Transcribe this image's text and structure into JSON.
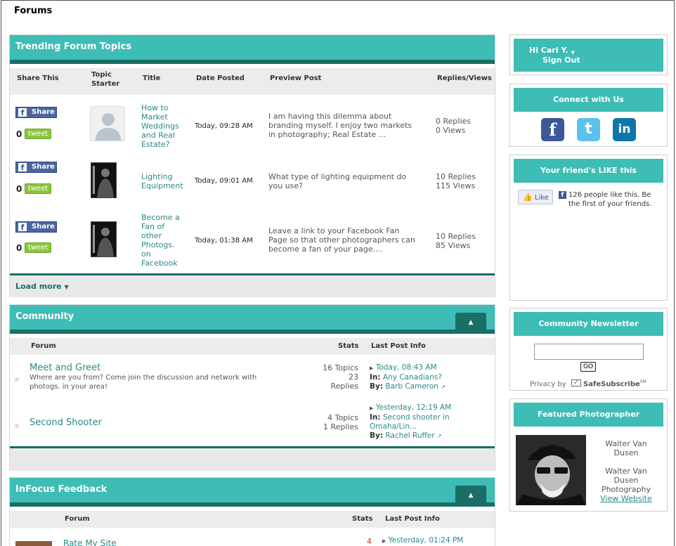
{
  "page": {
    "title": "Forums"
  },
  "trending": {
    "title": "Trending Forum Topics",
    "columns": [
      "Share This",
      "Topic Starter",
      "Title",
      "Date Posted",
      "Preview Post",
      "Replies/Views"
    ],
    "share_label": "Share",
    "tweet_label": "tweet",
    "tweet_count": "0",
    "rows": [
      {
        "title": [
          "How to",
          "Market",
          "Weddings",
          "and Real",
          "Estate?"
        ],
        "date": "Today, 09:28 AM",
        "preview": [
          "I am having this dilemma about",
          "branding myself. I enjoy two markets",
          "in photography; Real Estate ..."
        ],
        "replies": "0 Replies",
        "views": "0 Views"
      },
      {
        "title": [
          "Lighting",
          "Equipment"
        ],
        "date": "Today, 09:01 AM",
        "preview": [
          "What type of lighting equipment do",
          "you use?"
        ],
        "replies": "10 Replies",
        "views": "115 Views"
      },
      {
        "title": [
          "Become a",
          "Fan of",
          "other",
          "Photogs.",
          "on",
          "Facebook"
        ],
        "date": "Today, 01:38 AM",
        "preview": [
          "Leave a link to your Facebook Fan",
          "Page so that other photographers can",
          "become a fan of your page...."
        ],
        "replies": "10 Replies",
        "views": "85 Views"
      }
    ],
    "load_more": "Load more"
  },
  "community": {
    "title": "Community",
    "columns": {
      "forum": "Forum",
      "stats": "Stats",
      "last": "Last Post Info"
    },
    "forums": [
      {
        "name": "Meet and Greet",
        "desc": [
          "Where are you from? Come join the discussion and network with",
          "photogs. in your area!"
        ],
        "stats": [
          "16 Topics",
          "23",
          "Replies"
        ],
        "last_date": "Today, 08:43 AM",
        "in_label": "In:",
        "in_topic": [
          "Any Canadians?"
        ],
        "by_label": "By:",
        "by_user": "Barb Cameron"
      },
      {
        "name": "Second Shooter",
        "desc": [],
        "stats": [
          "4 Topics",
          "1 Replies"
        ],
        "last_date": "Yesterday, 12:19 AM",
        "in_label": "In:",
        "in_topic": [
          "Second shooter in",
          "Omaha/Lin..."
        ],
        "by_label": "By:",
        "by_user": "Rachel Ruffer"
      }
    ]
  },
  "feedback": {
    "title": "InFocus Feedback",
    "columns": {
      "forum": "Forum",
      "stats": "Stats",
      "last": "Last Post Info"
    },
    "forum_name": "Rate My Site",
    "stats": "4",
    "last_date": "Yesterday, 01:24 PM"
  },
  "sidebar": {
    "user": {
      "greeting": "Hi Carl Y.",
      "signout": "Sign Out"
    },
    "connect": {
      "title": "Connect with Us",
      "facebook": "f",
      "twitter": "t",
      "linkedin": "in"
    },
    "friends": {
      "title": "Your friend's LIKE this",
      "like_label": "Like",
      "like_text": [
        "126 people like this. Be",
        "the first of your friends."
      ]
    },
    "newsletter": {
      "title": "Community Newsletter",
      "go_label": "GO",
      "privacy_by": "Privacy by",
      "brand": "SafeSubscribe",
      "brand_sup": "SM"
    },
    "featured": {
      "title": "Featured Photographer",
      "name": [
        "Walter Van",
        "Dusen"
      ],
      "studio": [
        "Walter Van",
        "Dusen",
        "Photography"
      ],
      "website": "View Website"
    }
  },
  "colors": {
    "teal": "#3dbdb5",
    "dark_teal": "#1a6e66",
    "link": "#2a8a86"
  }
}
